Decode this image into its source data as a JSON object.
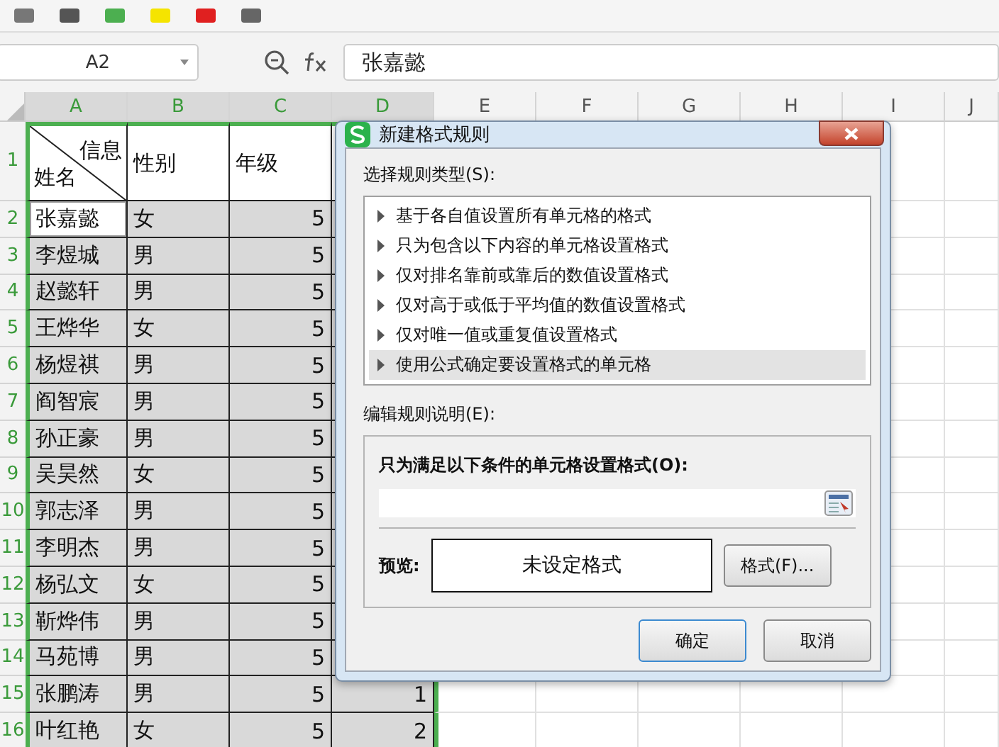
{
  "name_box": {
    "value": "A2"
  },
  "formula_bar": {
    "value": "张嘉懿"
  },
  "column_headers": [
    {
      "label": "A",
      "selected": true
    },
    {
      "label": "B",
      "selected": true
    },
    {
      "label": "C",
      "selected": true
    },
    {
      "label": "D",
      "selected": true
    },
    {
      "label": "E",
      "selected": false
    },
    {
      "label": "F",
      "selected": false
    },
    {
      "label": "G",
      "selected": false
    },
    {
      "label": "H",
      "selected": false
    },
    {
      "label": "I",
      "selected": false
    },
    {
      "label": "J",
      "selected": false
    }
  ],
  "header_row": {
    "number": "1",
    "selected": true,
    "diagonal_top": "信息",
    "diagonal_bottom": "姓名",
    "cells": [
      "性别",
      "年级"
    ]
  },
  "rows": [
    {
      "number": "2",
      "selected": true,
      "cells": [
        {
          "text": "张嘉懿",
          "active": true
        },
        {
          "text": "女",
          "active": false
        },
        {
          "text": "5",
          "active": false
        }
      ]
    },
    {
      "number": "3",
      "selected": true,
      "cells": [
        {
          "text": "李煜城",
          "active": false
        },
        {
          "text": "男",
          "active": false
        },
        {
          "text": "5",
          "active": false
        }
      ]
    },
    {
      "number": "4",
      "selected": true,
      "cells": [
        {
          "text": "赵懿轩",
          "active": false
        },
        {
          "text": "男",
          "active": false
        },
        {
          "text": "5",
          "active": false
        }
      ]
    },
    {
      "number": "5",
      "selected": true,
      "cells": [
        {
          "text": "王烨华",
          "active": false
        },
        {
          "text": "女",
          "active": false
        },
        {
          "text": "5",
          "active": false
        }
      ]
    },
    {
      "number": "6",
      "selected": true,
      "cells": [
        {
          "text": "杨煜祺",
          "active": false
        },
        {
          "text": "男",
          "active": false
        },
        {
          "text": "5",
          "active": false
        }
      ]
    },
    {
      "number": "7",
      "selected": true,
      "cells": [
        {
          "text": "阎智宸",
          "active": false
        },
        {
          "text": "男",
          "active": false
        },
        {
          "text": "5",
          "active": false
        }
      ]
    },
    {
      "number": "8",
      "selected": true,
      "cells": [
        {
          "text": "孙正豪",
          "active": false
        },
        {
          "text": "男",
          "active": false
        },
        {
          "text": "5",
          "active": false
        }
      ]
    },
    {
      "number": "9",
      "selected": true,
      "cells": [
        {
          "text": "吴昊然",
          "active": false
        },
        {
          "text": "女",
          "active": false
        },
        {
          "text": "5",
          "active": false
        }
      ]
    },
    {
      "number": "10",
      "selected": true,
      "cells": [
        {
          "text": "郭志泽",
          "active": false
        },
        {
          "text": "男",
          "active": false
        },
        {
          "text": "5",
          "active": false
        }
      ]
    },
    {
      "number": "11",
      "selected": true,
      "cells": [
        {
          "text": "李明杰",
          "active": false
        },
        {
          "text": "男",
          "active": false
        },
        {
          "text": "5",
          "active": false
        }
      ]
    },
    {
      "number": "12",
      "selected": true,
      "cells": [
        {
          "text": "杨弘文",
          "active": false
        },
        {
          "text": "女",
          "active": false
        },
        {
          "text": "5",
          "active": false
        }
      ]
    },
    {
      "number": "13",
      "selected": true,
      "cells": [
        {
          "text": "靳烨伟",
          "active": false
        },
        {
          "text": "男",
          "active": false
        },
        {
          "text": "5",
          "active": false
        }
      ]
    },
    {
      "number": "14",
      "selected": true,
      "cells": [
        {
          "text": "马苑博",
          "active": false
        },
        {
          "text": "男",
          "active": false
        },
        {
          "text": "5",
          "active": false
        }
      ]
    },
    {
      "number": "15",
      "selected": true,
      "cells": [
        {
          "text": "张鹏涛",
          "active": false
        },
        {
          "text": "男",
          "active": false
        },
        {
          "text": "5",
          "active": false
        },
        {
          "text": "1",
          "active": false
        }
      ]
    },
    {
      "number": "16",
      "selected": true,
      "cells": [
        {
          "text": "叶红艳",
          "active": false
        },
        {
          "text": "女",
          "active": false
        },
        {
          "text": "5",
          "active": false
        },
        {
          "text": "2",
          "active": false
        }
      ]
    }
  ],
  "dialog": {
    "title": "新建格式规则",
    "rule_type_label": "选择规则类型(S):",
    "rule_types": [
      {
        "label": "基于各自值设置所有单元格的格式",
        "selected": false
      },
      {
        "label": "只为包含以下内容的单元格设置格式",
        "selected": false
      },
      {
        "label": "仅对排名靠前或靠后的数值设置格式",
        "selected": false
      },
      {
        "label": "仅对高于或低于平均值的数值设置格式",
        "selected": false
      },
      {
        "label": "仅对唯一值或重复值设置格式",
        "selected": false
      },
      {
        "label": "使用公式确定要设置格式的单元格",
        "selected": true
      }
    ],
    "description_label": "编辑规则说明(E):",
    "condition_label": "只为满足以下条件的单元格设置格式(O):",
    "preview_label": "预览:",
    "preview_text": "未设定格式",
    "format_button": "格式(F)...",
    "buttons": [
      "确定",
      "取消"
    ]
  }
}
